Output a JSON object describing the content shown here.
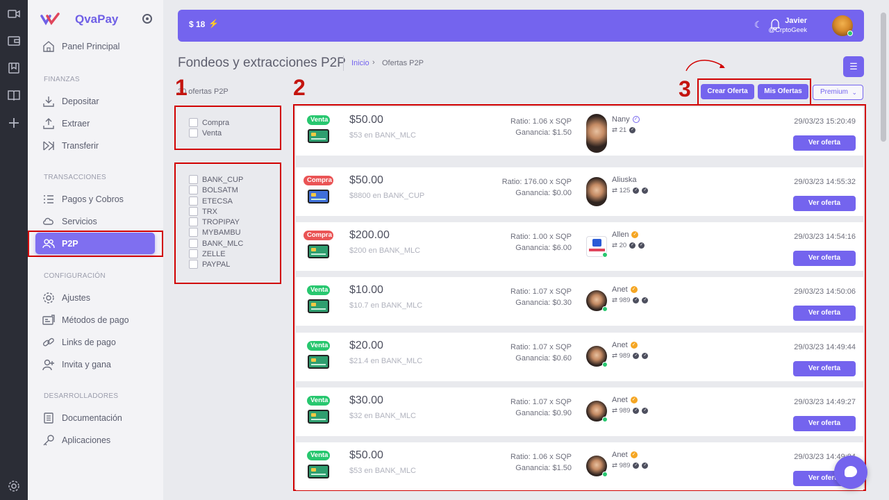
{
  "rail": {
    "icons": [
      "video-icon",
      "wallet-icon",
      "bookmark-icon",
      "book-icon",
      "plus-icon",
      "gear-icon"
    ]
  },
  "sidebar": {
    "brand": "QvaPay",
    "home": "Panel Principal",
    "sections": {
      "finanzas": "FINANZAS",
      "transacciones": "TRANSACCIONES",
      "configuracion": "CONFIGURACIÓN",
      "desarrolladores": "DESARROLLADORES"
    },
    "items": {
      "depositar": "Depositar",
      "extraer": "Extraer",
      "transferir": "Transferir",
      "pagos": "Pagos y Cobros",
      "servicios": "Servicios",
      "p2p": "P2P",
      "ajustes": "Ajustes",
      "metodos": "Métodos de pago",
      "links": "Links de pago",
      "invita": "Invita y gana",
      "documentacion": "Documentación",
      "aplicaciones": "Aplicaciones"
    }
  },
  "header": {
    "balance": "$ 18",
    "user_name": "Javier",
    "user_handle": "@CrptoGeek"
  },
  "page": {
    "title": "Fondeos y extracciones P2P",
    "breadcrumb_home": "Inicio",
    "breadcrumb_sep": "›",
    "breadcrumb_current": "Ofertas P2P",
    "count_label": "30 ofertas P2P"
  },
  "annotations": {
    "one": "1",
    "two": "2",
    "three": "3"
  },
  "actions": {
    "crear": "Crear Oferta",
    "mis": "Mis Ofertas",
    "premium": "Premium",
    "premium_chevron": "⌄"
  },
  "filters": {
    "types": [
      "Compra",
      "Venta"
    ],
    "methods": [
      "BANK_CUP",
      "BOLSATM",
      "ETECSA",
      "TRX",
      "TROPIPAY",
      "MYBAMBU",
      "BANK_MLC",
      "ZELLE",
      "PAYPAL"
    ]
  },
  "offers": [
    {
      "type": "Venta",
      "amount": "$50.00",
      "sub": "$53 en BANK_MLC",
      "ratio": "Ratio: 1.06 x SQP",
      "gain": "Ganancia: $1.50",
      "seller": "Nany",
      "verified": "blue",
      "trades": "21",
      "datetime": "29/03/23 15:20:49",
      "button": "Ver oferta"
    },
    {
      "type": "Compra",
      "amount": "$50.00",
      "sub": "$8800 en BANK_CUP",
      "ratio": "Ratio: 176.00 x SQP",
      "gain": "Ganancia: $0.00",
      "seller": "Aliuska",
      "verified": "",
      "trades": "125",
      "datetime": "29/03/23 14:55:32",
      "button": "Ver oferta"
    },
    {
      "type": "Compra",
      "amount": "$200.00",
      "sub": "$200 en BANK_MLC",
      "ratio": "Ratio: 1.00 x SQP",
      "gain": "Ganancia: $6.00",
      "seller": "Allen",
      "verified": "orange",
      "trades": "20",
      "datetime": "29/03/23 14:54:16",
      "button": "Ver oferta"
    },
    {
      "type": "Venta",
      "amount": "$10.00",
      "sub": "$10.7 en BANK_MLC",
      "ratio": "Ratio: 1.07 x SQP",
      "gain": "Ganancia: $0.30",
      "seller": "Anet",
      "verified": "orange",
      "trades": "989",
      "datetime": "29/03/23 14:50:06",
      "button": "Ver oferta"
    },
    {
      "type": "Venta",
      "amount": "$20.00",
      "sub": "$21.4 en BANK_MLC",
      "ratio": "Ratio: 1.07 x SQP",
      "gain": "Ganancia: $0.60",
      "seller": "Anet",
      "verified": "orange",
      "trades": "989",
      "datetime": "29/03/23 14:49:44",
      "button": "Ver oferta"
    },
    {
      "type": "Venta",
      "amount": "$30.00",
      "sub": "$32 en BANK_MLC",
      "ratio": "Ratio: 1.07 x SQP",
      "gain": "Ganancia: $0.90",
      "seller": "Anet",
      "verified": "orange",
      "trades": "989",
      "datetime": "29/03/23 14:49:27",
      "button": "Ver oferta"
    },
    {
      "type": "Venta",
      "amount": "$50.00",
      "sub": "$53 en BANK_MLC",
      "ratio": "Ratio: 1.06 x SQP",
      "gain": "Ganancia: $1.50",
      "seller": "Anet",
      "verified": "orange",
      "trades": "989",
      "datetime": "29/03/23 14:49:04",
      "button": "Ver oferta"
    }
  ],
  "colors": {
    "accent": "#7464ee",
    "venta": "#28c76f",
    "compra": "#ea5455",
    "annotation": "#d10000"
  }
}
